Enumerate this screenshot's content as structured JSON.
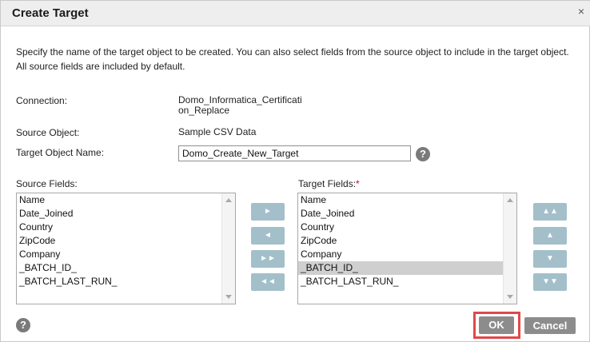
{
  "dialog": {
    "title": "Create Target",
    "close_icon": "×",
    "description": "Specify the name of the target object to be created. You can also select fields from the source object to include in the target object. All source fields are included by default."
  },
  "form": {
    "connection_label": "Connection:",
    "connection_value_line1": "Domo_Informatica_Certificati",
    "connection_value_line2": "on_Replace",
    "source_object_label": "Source Object:",
    "source_object_value": "Sample CSV Data",
    "target_name_label": "Target Object Name:",
    "target_name_value": "Domo_Create_New_Target",
    "help_glyph": "?"
  },
  "source_fields": {
    "label": "Source Fields:",
    "items": [
      "Name",
      "Date_Joined",
      "Country",
      "ZipCode",
      "Company",
      "_BATCH_ID_",
      "_BATCH_LAST_RUN_"
    ]
  },
  "target_fields": {
    "label": "Target Fields:",
    "required_mark": "*",
    "items": [
      "Name",
      "Date_Joined",
      "Country",
      "ZipCode",
      "Company",
      "_BATCH_ID_",
      "_BATCH_LAST_RUN_"
    ],
    "selected_index": 5
  },
  "move_buttons": {
    "add": "►",
    "remove": "◄",
    "add_all": "►►",
    "remove_all": "◄◄"
  },
  "order_buttons": {
    "top": "▲▲",
    "up": "▲",
    "down": "▼",
    "bottom": "▼▼"
  },
  "footer": {
    "help_glyph": "?",
    "ok_label": "OK",
    "cancel_label": "Cancel"
  },
  "colors": {
    "move_button": "#a3bfca",
    "action_button": "#8c8c8c",
    "highlight_border": "#e0484a",
    "required": "#d0021b"
  }
}
